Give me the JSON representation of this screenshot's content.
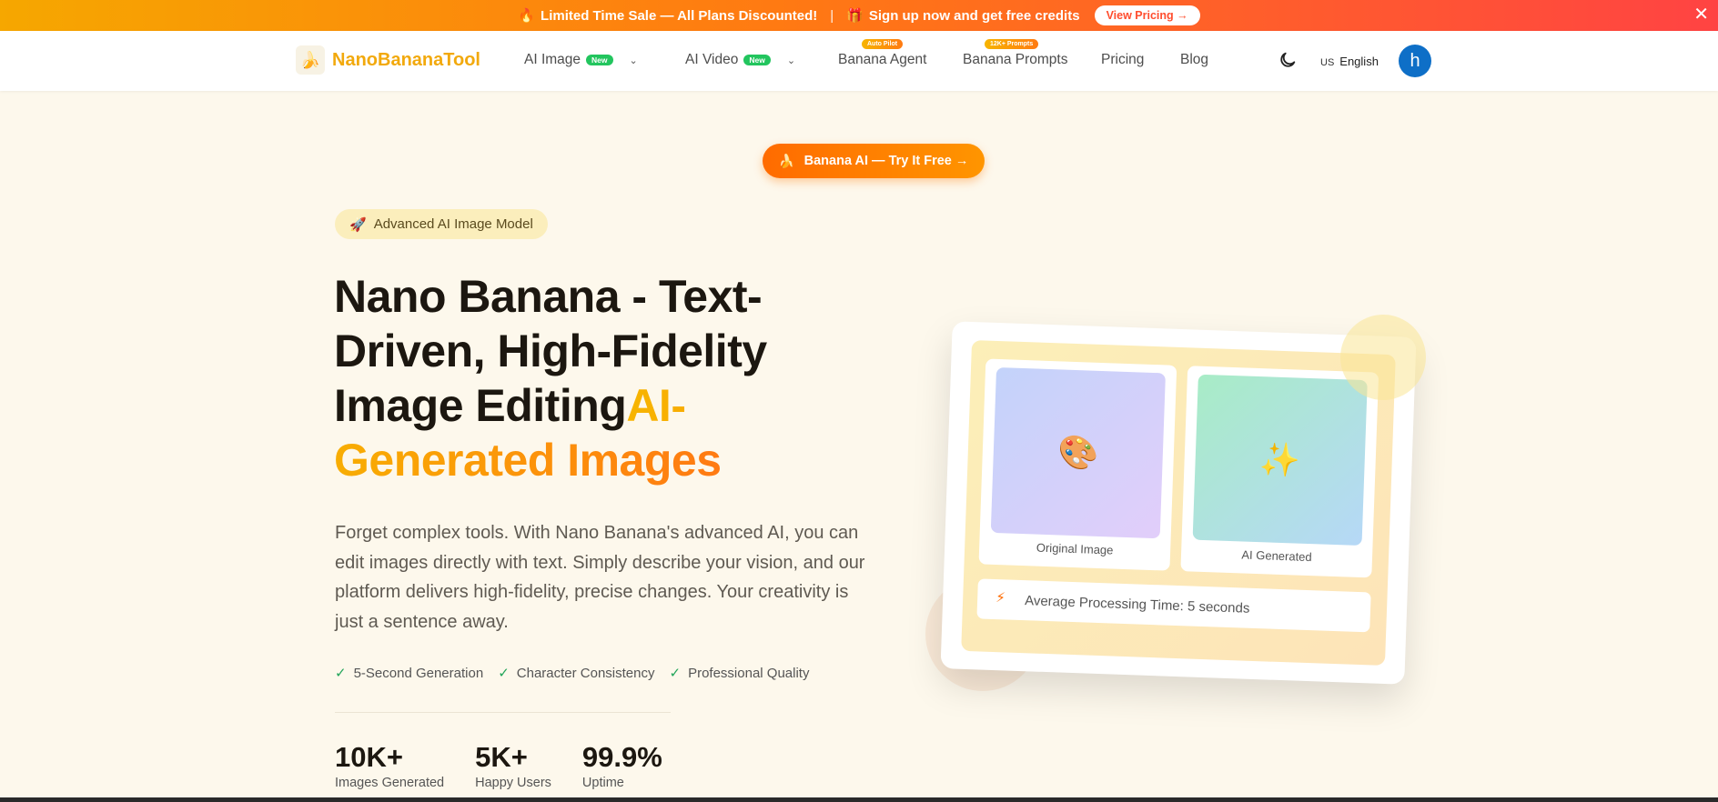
{
  "promo": {
    "fire_emoji": "🔥",
    "sale_text": "Limited Time Sale — All Plans Discounted!",
    "separator": "|",
    "gift_emoji": "🎁",
    "signup_text": "Sign up now and get free credits",
    "button_label": "View Pricing →",
    "close_label": "✕"
  },
  "nav": {
    "logo_emoji": "🍌",
    "brand": "NanoBananaTool",
    "items": [
      {
        "label": "AI Image",
        "badge": "New"
      },
      {
        "label": "AI Video",
        "badge": "New"
      },
      {
        "label": "Banana Agent",
        "badge": "Auto Pilot"
      },
      {
        "label": "Banana Prompts",
        "badge": "12K+ Prompts"
      },
      {
        "label": "Pricing"
      },
      {
        "label": "Blog"
      }
    ],
    "chevron": "⌄",
    "lang_code": "US",
    "lang_label": "English",
    "avatar_initial": "h"
  },
  "hero": {
    "cta_emoji": "🍌",
    "cta_label": "Banana AI — Try It Free →",
    "pill_emoji": "🚀",
    "pill_label": "Advanced AI Image Model",
    "headline_main": "Nano Banana - Text-Driven, High-Fidelity Image Editing",
    "headline_accent": "AI-Generated Images",
    "description": "Forget complex tools. With Nano Banana's advanced AI, you can edit images directly with text. Simply describe your vision, and our platform delivers high-fidelity, precise changes. Your creativity is just a sentence away.",
    "check": "✓",
    "features": [
      "5-Second Generation",
      "Character Consistency",
      "Professional Quality"
    ],
    "stats": [
      {
        "value": "10K+",
        "label": "Images Generated"
      },
      {
        "value": "5K+",
        "label": "Happy Users"
      },
      {
        "value": "99.9%",
        "label": "Uptime"
      }
    ]
  },
  "illustration": {
    "original_emoji": "🎨",
    "original_caption": "Original Image",
    "generated_emoji": "✨",
    "generated_caption": "AI Generated",
    "bolt_emoji": "⚡",
    "processing_text": "Average Processing Time: 5 seconds"
  },
  "colors": {
    "accent": "#f7b500",
    "accent_orange": "#ff7a12",
    "avatar": "#0e6fc7",
    "background": "#fdf8ec",
    "new_badge": "#22c55e"
  }
}
